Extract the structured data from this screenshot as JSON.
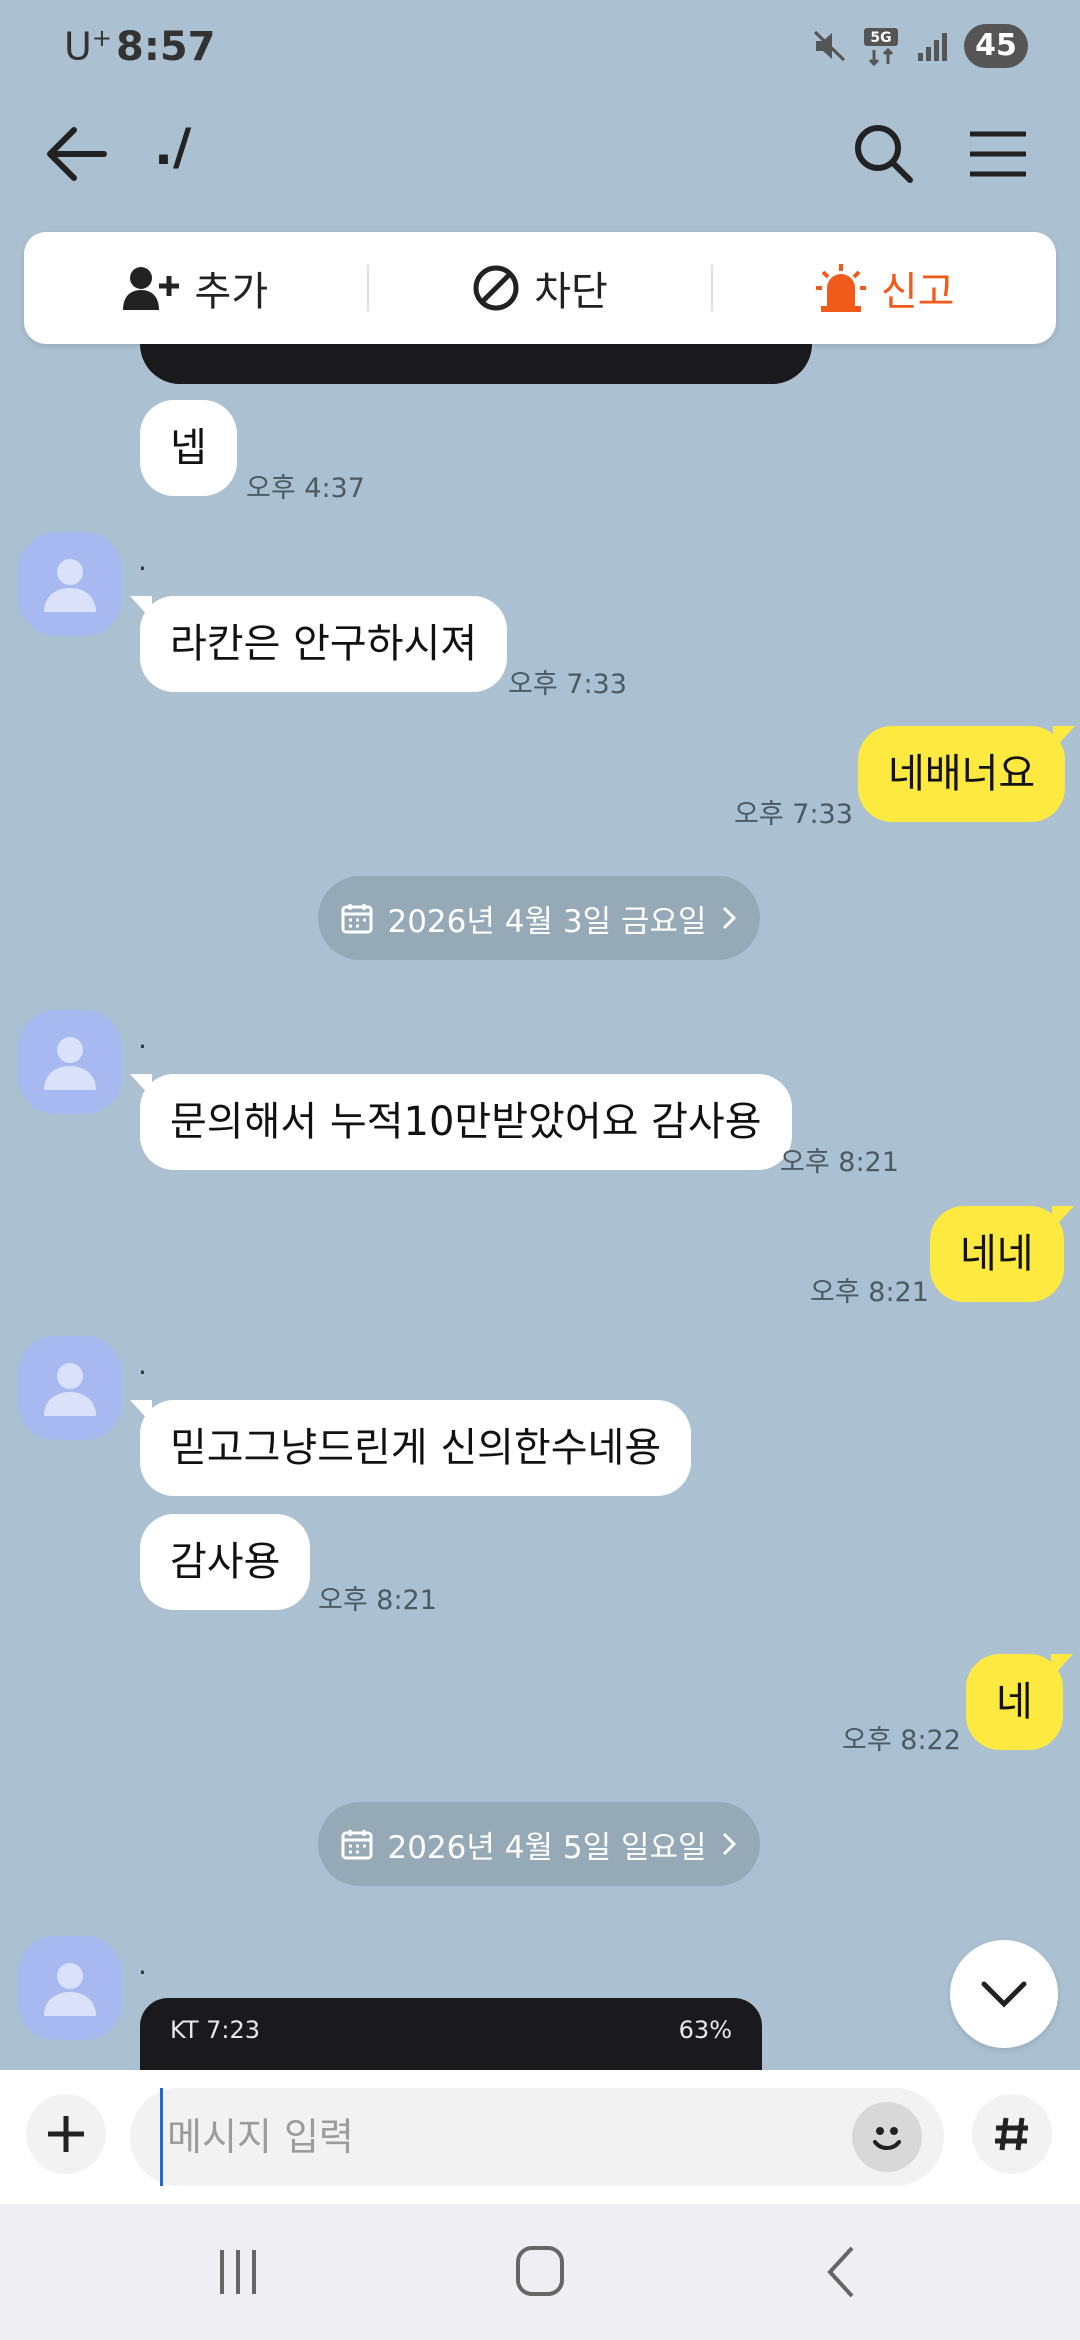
{
  "status_bar": {
    "carrier": "U",
    "carrier_sup": "+",
    "time": "8:57",
    "battery": "45"
  },
  "header": {
    "title": "./"
  },
  "actions": {
    "add": "추가",
    "block": "차단",
    "report": "신고"
  },
  "messages": {
    "m1": {
      "text": "넵",
      "time": "오후 4:37"
    },
    "m2": {
      "sender": ".",
      "text": "라칸은 안구하시져",
      "time": "오후 7:33"
    },
    "m3": {
      "text": "네배너요",
      "time": "오후 7:33"
    },
    "date1": "2026년 4월 3일 금요일",
    "m4": {
      "sender": ".",
      "text": "문의해서 누적10만받았어요 감사용",
      "time": "오후 8:21"
    },
    "m5": {
      "text": "네네",
      "time": "오후 8:21"
    },
    "m6": {
      "sender": ".",
      "text": "믿고그냥드린게 신의한수네용"
    },
    "m7": {
      "text": "감사용",
      "time": "오후 8:21"
    },
    "m8": {
      "text": "네",
      "time": "오후 8:22"
    },
    "date2": "2026년 4월 5일 일요일",
    "m9": {
      "sender": ".",
      "image_status_left": "KT 7:23",
      "image_status_right": "63%"
    }
  },
  "input": {
    "placeholder": "메시지 입력",
    "value": ""
  },
  "colors": {
    "background": "#abc1d1",
    "my_bubble": "#fde93f",
    "their_bubble": "#ffffff",
    "report": "#f05a1a"
  },
  "icons": [
    "back-arrow-icon",
    "search-icon",
    "menu-icon",
    "add-friend-icon",
    "block-icon",
    "siren-icon",
    "calendar-icon",
    "chevron-right-icon",
    "chevron-down-icon",
    "plus-icon",
    "emoji-icon",
    "hash-icon",
    "recents-icon",
    "home-icon",
    "back-icon"
  ]
}
